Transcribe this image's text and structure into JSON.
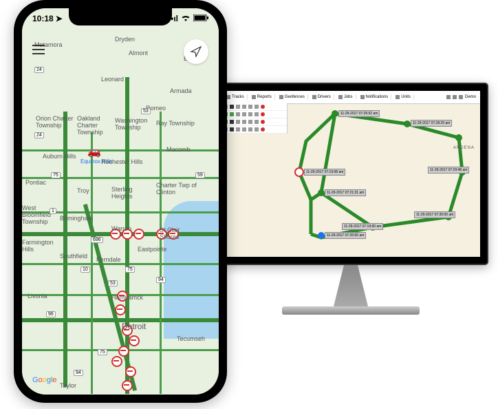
{
  "phone": {
    "time": "10:18",
    "vehicle_label": "Equinox Hills",
    "cities": {
      "metamora": "Metamora",
      "dryden": "Dryden",
      "almont": "Almont",
      "berville": "Berville",
      "leonard": "Leonard",
      "armada": "Armada",
      "romeo": "Romeo",
      "orion": "Orion Charter Township",
      "oakland": "Oakland Charter Township",
      "washington": "Washington Township",
      "ray": "Ray Township",
      "auburn": "Auburn Hills",
      "rochester": "Rochester Hills",
      "macomb": "Macomb",
      "pontiac": "Pontiac",
      "troy": "Troy",
      "sterling": "Sterling Heights",
      "clinton": "Charter Twp of Clinton",
      "bloomfield": "West Bloomfield Township",
      "birmingham": "Birmingham",
      "warren": "Warren",
      "shores": "St Clair Shores",
      "farmington": "Farmington Hills",
      "southfield": "Southfield",
      "ferndale": "Ferndale",
      "eastpointe": "Eastpointe",
      "livonia": "Livonia",
      "hamtramck": "Hamtramck",
      "detroit": "Detroit",
      "taylor": "Taylor",
      "tecumseh": "Tecumseh"
    },
    "highways": {
      "h24": "24",
      "h53": "53",
      "h75": "75",
      "h59": "59",
      "h696": "696",
      "h94": "94",
      "h96": "96",
      "h10": "10",
      "h1": "1"
    },
    "google": {
      "g": "G",
      "o1": "o",
      "o2": "o",
      "g2": "g",
      "l": "l",
      "e": "e"
    }
  },
  "desktop": {
    "tabs": {
      "tracks": "Tracks",
      "reports": "Reports",
      "geofences": "Geofences",
      "drivers": "Drivers",
      "jobs": "Jobs",
      "notifications": "Notifications",
      "units": "Units"
    },
    "user": "Demo",
    "waypoints": [
      {
        "id": "wp1",
        "ts": "11-29-2017 07:26:52 am"
      },
      {
        "id": "wp2",
        "ts": "11-29-2017 07:28:29 am"
      },
      {
        "id": "wp3",
        "ts": "11-29-2017 07:29:48 am"
      },
      {
        "id": "wp4",
        "ts": "11-29-2017 07:30:00 am"
      },
      {
        "id": "wp5",
        "ts": "11-29-2017 07:19:00 am"
      },
      {
        "id": "wp6",
        "ts": "11-29-2017 07:20:00 am"
      },
      {
        "id": "wp7",
        "ts": "11-29-2017 07:21:31 am"
      },
      {
        "id": "wp8",
        "ts": "11-29-2017 07:19:08 am"
      }
    ],
    "area": "ARDENA"
  }
}
